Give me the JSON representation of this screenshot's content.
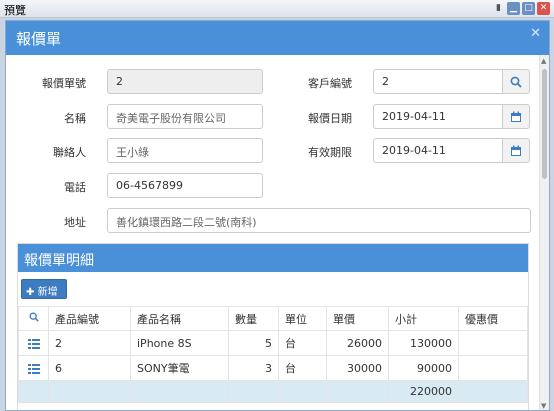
{
  "window": {
    "title": "預覽"
  },
  "dialog": {
    "title": "報價單"
  },
  "form": {
    "quote_no": {
      "label": "報價單號",
      "value": "2"
    },
    "customer_no": {
      "label": "客戶編號",
      "value": "2"
    },
    "name": {
      "label": "名稱",
      "value": "奇美電子股份有限公司"
    },
    "quote_date": {
      "label": "報價日期",
      "value": "2019-04-11"
    },
    "contact": {
      "label": "聯絡人",
      "value": "王小綠"
    },
    "valid_until": {
      "label": "有效期限",
      "value": "2019-04-11"
    },
    "phone": {
      "label": "電話",
      "value": "06-4567899"
    },
    "address": {
      "label": "地址",
      "value": "善化鎮環西路二段二號(南科)"
    }
  },
  "detail": {
    "title": "報價單明細",
    "add_label": "新增",
    "columns": [
      "產品編號",
      "產品名稱",
      "數量",
      "單位",
      "單價",
      "小計",
      "優惠價"
    ],
    "rows": [
      {
        "product_no": "2",
        "product_name": "iPhone 8S",
        "qty": "5",
        "unit": "台",
        "price": "26000",
        "subtotal": "130000",
        "discount": ""
      },
      {
        "product_no": "6",
        "product_name": "SONY筆電",
        "qty": "3",
        "unit": "台",
        "price": "30000",
        "subtotal": "90000",
        "discount": ""
      }
    ],
    "total": "220000"
  },
  "colors": {
    "primary": "#4a90d9",
    "total_row": "#d8ebf2"
  }
}
